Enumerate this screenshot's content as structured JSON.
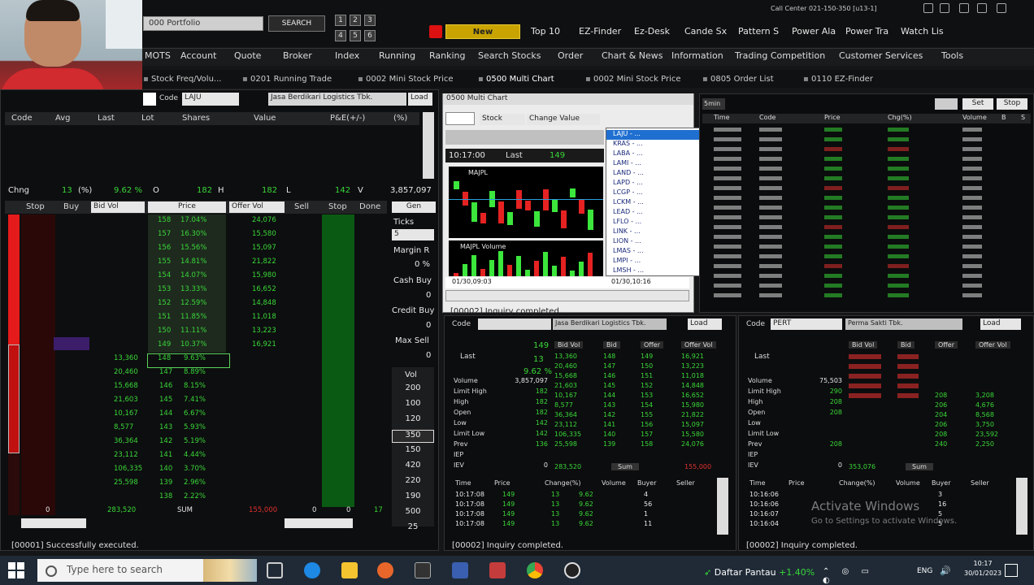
{
  "topbar": {
    "portfolio": "000 Portfolio",
    "search_label": "SEARCH",
    "num_buttons": [
      "1",
      "2",
      "3",
      "4",
      "5",
      "6"
    ],
    "new_label": "New",
    "menu": [
      "Top 10",
      "EZ-Finder",
      "Ez-Desk",
      "Cande Sx",
      "Pattern S",
      "Power Ala",
      "Power Tra",
      "Watch Lis"
    ],
    "call_center": "Call Center 021-150-350 [u13-1]"
  },
  "menubar": [
    "MOTS",
    "Account",
    "Quote",
    "Broker",
    "Index",
    "Running",
    "Ranking",
    "Search Stocks",
    "Order",
    "Chart & News",
    "Information",
    "Trading Competition",
    "Customer Services",
    "Tools"
  ],
  "tabs": [
    "Stock Freq/Volu...",
    "0201 Running Trade",
    "0002 Mini Stock Price",
    "0500 Multi Chart",
    "0002 Mini Stock Price",
    "0805 Order List",
    "0110 EZ-Finder"
  ],
  "left": {
    "code_label": "Code",
    "code_value": "LAJU",
    "company": "Jasa Berdikari Logistics Tbk.",
    "load": "Load",
    "header": [
      "Code",
      "Avg",
      "Last",
      "Lot",
      "Shares",
      "Value",
      "P&E(+/-)",
      "(%)"
    ],
    "chg_label": "Chng",
    "chg": "13",
    "pct": "9.62 %",
    "o_label": "O",
    "o": "182",
    "h_label": "H",
    "h": "182",
    "l_label": "L",
    "l": "142",
    "v_label": "V",
    "v": "3,857,097",
    "book_header": [
      "Stop",
      "Buy",
      "Bid Vol",
      "Price",
      "Offer Vol",
      "Sell",
      "Stop",
      "Done"
    ],
    "offers": [
      {
        "p": "158",
        "pct": "17.04%",
        "v": "24,076"
      },
      {
        "p": "157",
        "pct": "16.30%",
        "v": "15,580"
      },
      {
        "p": "156",
        "pct": "15.56%",
        "v": "15,097"
      },
      {
        "p": "155",
        "pct": "14.81%",
        "v": "21,822"
      },
      {
        "p": "154",
        "pct": "14.07%",
        "v": "15,980"
      },
      {
        "p": "153",
        "pct": "13.33%",
        "v": "16,652"
      },
      {
        "p": "152",
        "pct": "12.59%",
        "v": "14,848"
      },
      {
        "p": "151",
        "pct": "11.85%",
        "v": "11,018"
      },
      {
        "p": "150",
        "pct": "11.11%",
        "v": "13,223"
      },
      {
        "p": "149",
        "pct": "10.37%",
        "v": "16,921"
      }
    ],
    "bids": [
      {
        "b": "13,360",
        "p": "148",
        "pct": "9.63%"
      },
      {
        "b": "20,460",
        "p": "147",
        "pct": "8.89%"
      },
      {
        "b": "15,668",
        "p": "146",
        "pct": "8.15%"
      },
      {
        "b": "21,603",
        "p": "145",
        "pct": "7.41%"
      },
      {
        "b": "10,167",
        "p": "144",
        "pct": "6.67%"
      },
      {
        "b": "8,577",
        "p": "143",
        "pct": "5.93%"
      },
      {
        "b": "36,364",
        "p": "142",
        "pct": "5.19%"
      },
      {
        "b": "23,112",
        "p": "141",
        "pct": "4.44%"
      },
      {
        "b": "106,335",
        "p": "140",
        "pct": "3.70%"
      },
      {
        "b": "25,598",
        "p": "139",
        "pct": "2.96%"
      },
      {
        "b": "",
        "p": "138",
        "pct": "2.22%"
      }
    ],
    "sum_left": "0",
    "sum_bid": "283,520",
    "sum_label": "SUM",
    "sum_offer": "155,000",
    "sum_right": "0",
    "sum_stop": "0",
    "sum_done": "17",
    "side": {
      "gen": "Gen",
      "ticks": "Ticks",
      "ticks_val": "5",
      "margin": "Margin R",
      "margin_val": "0 %",
      "cashbuy": "Cash Buy",
      "cashbuy_val": "0",
      "creditbuy": "Credit Buy",
      "creditbuy_val": "0",
      "maxsell": "Max Sell",
      "maxsell_val": "0",
      "vol": "Vol",
      "vols": [
        "200",
        "100",
        "120",
        "350",
        "150",
        "420",
        "220",
        "190",
        "500",
        "25"
      ]
    },
    "status": "[00001] Successfully executed."
  },
  "chartwin": {
    "title": "0500 Multi Chart",
    "stock": "Stock",
    "change_value": "Change Value",
    "time": "10:17:00",
    "last": "Last",
    "price": "149",
    "symbol": "MAJPL",
    "volume_label": "MAJPL Volume",
    "date_left": "01/30,09:03",
    "date_right": "01/30,10:16",
    "status": "[00002] Inquiry completed."
  },
  "dropdown": [
    "LAJU - ...",
    "KRAS - ...",
    "LABA - ...",
    "LAMI - ...",
    "LAND - ...",
    "LAPD - ...",
    "LCGP - ...",
    "LCKM - ...",
    "LEAD - ...",
    "LFLO - ...",
    "LINK - ...",
    "LION - ...",
    "LMAS - ...",
    "LMPI - ...",
    "LMSH - ..."
  ],
  "righttop": {
    "tab1": "5min",
    "tab2": "Set",
    "tab3": "Stop",
    "header": [
      "Time",
      "Code",
      "Price",
      "Chg(%)",
      "Volume",
      "B",
      "S"
    ]
  },
  "midquote": {
    "code_label": "Code",
    "company": "Jasa Berdikari Logistics Tbk.",
    "load": "Load",
    "last_label": "Last",
    "last": "149",
    "chg": "13",
    "chgp": "9.62 %",
    "labels": [
      "Volume",
      "Limit High",
      "High",
      "Open",
      "Low",
      "Limit Low",
      "Prev",
      "IEP",
      "IEV"
    ],
    "vals": [
      "3,857,097",
      "182",
      "182",
      "182",
      "142",
      "142",
      "136",
      "",
      "0"
    ],
    "book_header": [
      "Bid Vol",
      "Bid",
      "Offer",
      "Offer Vol"
    ],
    "rows": [
      [
        "13,360",
        "148",
        "149",
        "16,921"
      ],
      [
        "20,460",
        "147",
        "150",
        "13,223"
      ],
      [
        "15,668",
        "146",
        "151",
        "11,018"
      ],
      [
        "21,603",
        "145",
        "152",
        "14,848"
      ],
      [
        "10,167",
        "144",
        "153",
        "16,652"
      ],
      [
        "8,577",
        "143",
        "154",
        "15,980"
      ],
      [
        "36,364",
        "142",
        "155",
        "21,822"
      ],
      [
        "23,112",
        "141",
        "156",
        "15,097"
      ],
      [
        "106,335",
        "140",
        "157",
        "15,580"
      ],
      [
        "25,598",
        "139",
        "158",
        "24,076"
      ]
    ],
    "sum_bid": "283,520",
    "sum_label": "Sum",
    "sum_offer": "155,000",
    "trade_header": [
      "Time",
      "Price",
      "Change(%)",
      "Volume",
      "Buyer",
      "Seller"
    ],
    "trades": [
      [
        "10:17:08",
        "149",
        "13",
        "9.62",
        "4"
      ],
      [
        "10:17:08",
        "149",
        "13",
        "9.62",
        "56"
      ],
      [
        "10:17:08",
        "149",
        "13",
        "9.62",
        "1"
      ],
      [
        "10:17:08",
        "149",
        "13",
        "9.62",
        "11"
      ]
    ],
    "status": "[00002] Inquiry completed."
  },
  "rightquote": {
    "code_label": "Code",
    "code_value": "PERT",
    "company": "Perma Sakti Tbk.",
    "load": "Load",
    "last_label": "Last",
    "labels": [
      "Volume",
      "Limit High",
      "High",
      "Open",
      "Low",
      "Limit Low",
      "Prev",
      "IEP",
      "IEV"
    ],
    "vals": [
      "75,503",
      "290",
      "208",
      "208",
      "",
      "",
      "208",
      "",
      "0"
    ],
    "book_header": [
      "Bid Vol",
      "Bid",
      "Offer",
      "Offer Vol"
    ],
    "right_offer": [
      "",
      "",
      "",
      "",
      "208",
      "206",
      "204",
      "206",
      "208",
      "240"
    ],
    "right_offervol": [
      "",
      "",
      "",
      "",
      "3,208",
      "4,676",
      "8,568",
      "3,750",
      "23,592",
      "2,250"
    ],
    "sum_bid": "353,076",
    "sum_label": "Sum",
    "trade_header": [
      "Time",
      "Price",
      "Change(%)",
      "Volume",
      "Buyer",
      "Seller"
    ],
    "trades": [
      [
        "10:16:06",
        "",
        "",
        "",
        "3"
      ],
      [
        "10:16:06",
        "",
        "",
        "",
        "16"
      ],
      [
        "10:16:07",
        "",
        "",
        "",
        "5"
      ],
      [
        "10:16:04",
        "",
        "",
        "",
        "5"
      ]
    ],
    "status": "[00002] Inquiry completed."
  },
  "watermark": {
    "line1": "Activate Windows",
    "line2": "Go to Settings to activate Windows."
  },
  "taskbar": {
    "search_placeholder": "Type here to search",
    "tray_label": "Daftar Pantau",
    "tray_change": "+1.40%",
    "lang": "ENG",
    "time": "10:17",
    "date": "30/01/2023"
  },
  "colors": {
    "up": "#39d739",
    "down": "#e03030",
    "accent": "#c9a400"
  }
}
